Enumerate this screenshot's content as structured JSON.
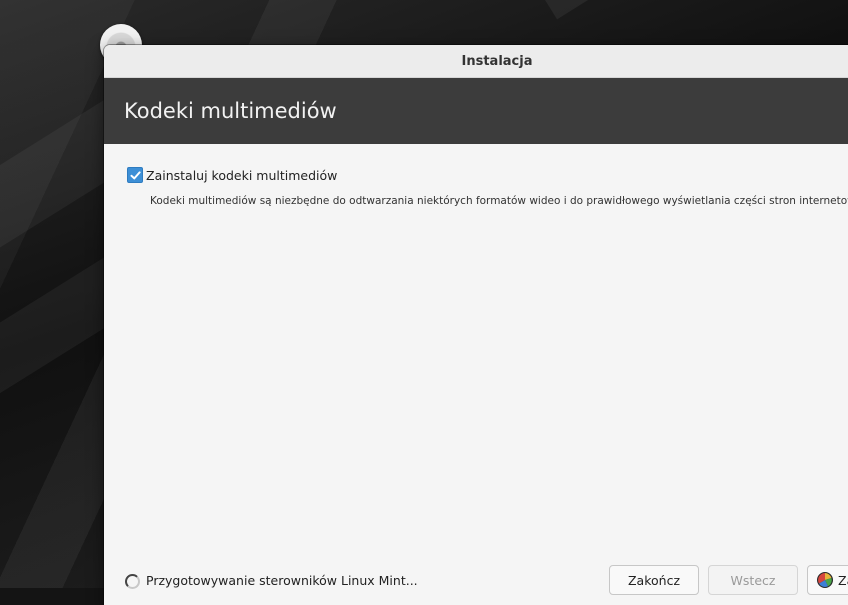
{
  "window": {
    "title": "Instalacja"
  },
  "header": {
    "heading": "Kodeki multimediów"
  },
  "codecs": {
    "checkbox_checked": true,
    "checkbox_label": "Zainstaluj kodeki multimediów",
    "description": "Kodeki multimediów są niezbędne do odtwarzania niektórych formatów wideo i do prawidłowego wyświetlania części stron internetowych."
  },
  "status": {
    "text": "Przygotowywanie sterowników Linux Mint..."
  },
  "buttons": {
    "quit_label": "Zakończ",
    "back_label": "Wstecz",
    "next_label": "Zap"
  },
  "colors": {
    "accent": "#3d8fd6",
    "header_bg": "#3c3c3c",
    "window_bg": "#f5f5f5"
  },
  "icons": {
    "checkbox": "check-icon",
    "spinner": "spinner-icon",
    "next": "apply-icon",
    "desktop": "disc-icon"
  }
}
